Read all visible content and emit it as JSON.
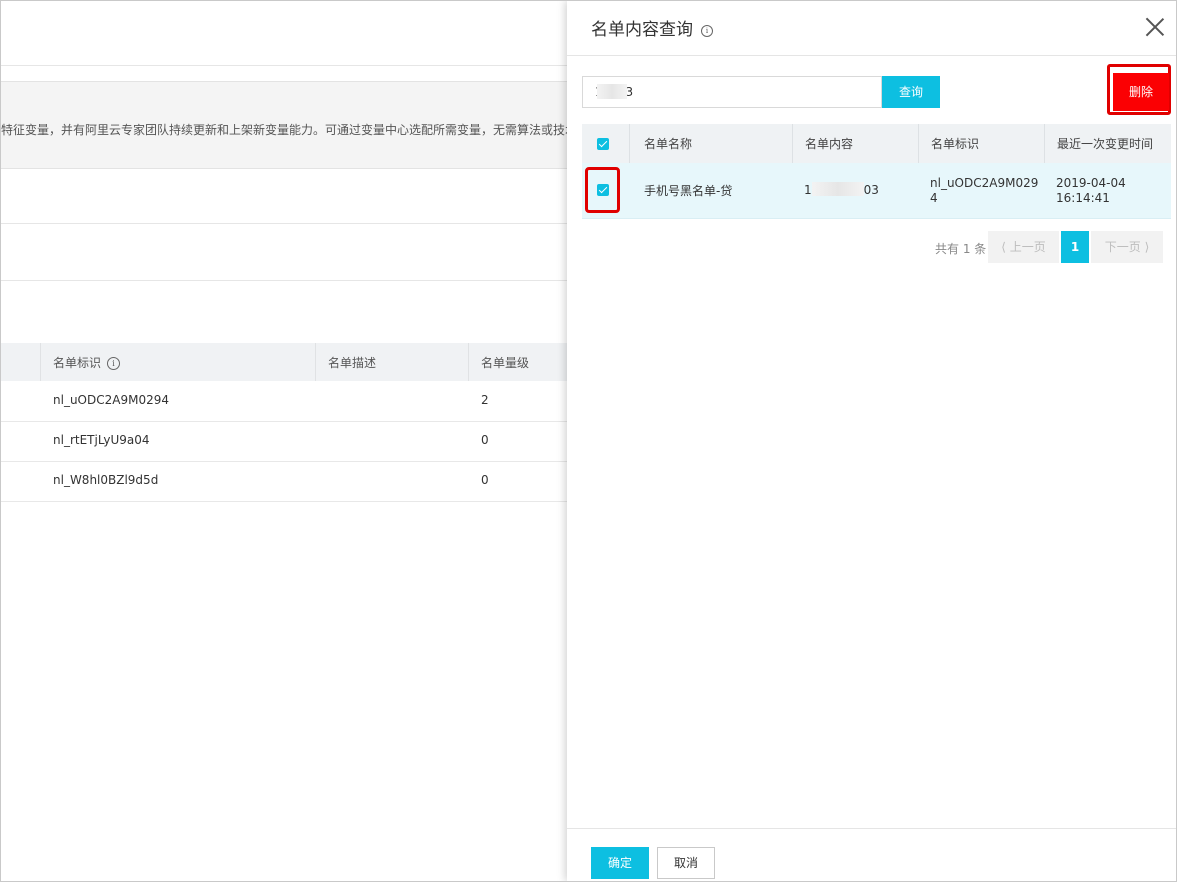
{
  "background": {
    "notice_text": "特征变量，并有阿里云专家团队持续更新和上架新变量能力。可通过变量中心选配所需变量，无需算法或技术",
    "table": {
      "columns": [
        "名单标识",
        "名单描述",
        "名单量级"
      ],
      "rows": [
        {
          "id": "nl_uODC2A9M0294",
          "desc": "",
          "count": "2"
        },
        {
          "id": "nl_rtETjLyU9a04",
          "desc": "",
          "count": "0"
        },
        {
          "id": "nl_W8hl0BZl9d5d",
          "desc": "",
          "count": "0"
        }
      ]
    }
  },
  "drawer": {
    "title": "名单内容查询",
    "search": {
      "value": "17003",
      "button": "查询"
    },
    "delete_button": "删除",
    "table": {
      "columns": [
        "名单名称",
        "名单内容",
        "名单标识",
        "最近一次变更时间"
      ],
      "rows": [
        {
          "name": "手机号黑名单-贷",
          "content_prefix": "1",
          "content_suffix": "03",
          "id_line1": "nl_uODC2A9M029",
          "id_line2": "4",
          "time_line1": "2019-04-04",
          "time_line2": "16:14:41",
          "checked": true
        }
      ]
    },
    "pagination": {
      "total": "共有 1 条",
      "prev": "上一页",
      "current": "1",
      "next": "下一页"
    },
    "footer": {
      "ok": "确定",
      "cancel": "取消"
    }
  },
  "colors": {
    "primary": "#0dbfe1",
    "danger": "#fb0003",
    "highlight_border": "#e00000",
    "selected_row": "#e7f7fb"
  }
}
